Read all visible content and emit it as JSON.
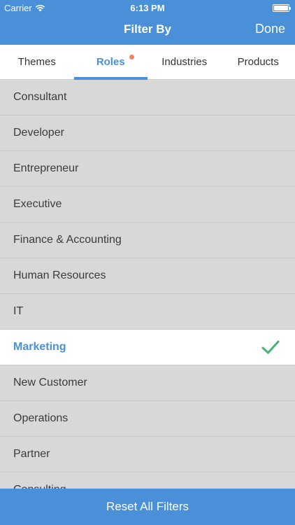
{
  "status_bar": {
    "carrier": "Carrier",
    "time": "6:13 PM"
  },
  "nav": {
    "title": "Filter By",
    "done_label": "Done"
  },
  "tabs": [
    {
      "label": "Themes",
      "active": false
    },
    {
      "label": "Roles",
      "active": true,
      "badge_dot": true
    },
    {
      "label": "Industries",
      "active": false
    },
    {
      "label": "Products",
      "active": false
    }
  ],
  "roles": [
    {
      "label": "Consultant",
      "selected": false
    },
    {
      "label": "Developer",
      "selected": false
    },
    {
      "label": "Entrepreneur",
      "selected": false
    },
    {
      "label": "Executive",
      "selected": false
    },
    {
      "label": "Finance & Accounting",
      "selected": false
    },
    {
      "label": "Human Resources",
      "selected": false
    },
    {
      "label": "IT",
      "selected": false
    },
    {
      "label": "Marketing",
      "selected": true
    },
    {
      "label": "New Customer",
      "selected": false
    },
    {
      "label": "Operations",
      "selected": false
    },
    {
      "label": "Partner",
      "selected": false
    },
    {
      "label": "Consulting",
      "selected": false
    }
  ],
  "footer": {
    "reset_label": "Reset All Filters"
  },
  "colors": {
    "accent": "#4a90d9",
    "check": "#4caf7a",
    "badge": "#f0845c"
  }
}
